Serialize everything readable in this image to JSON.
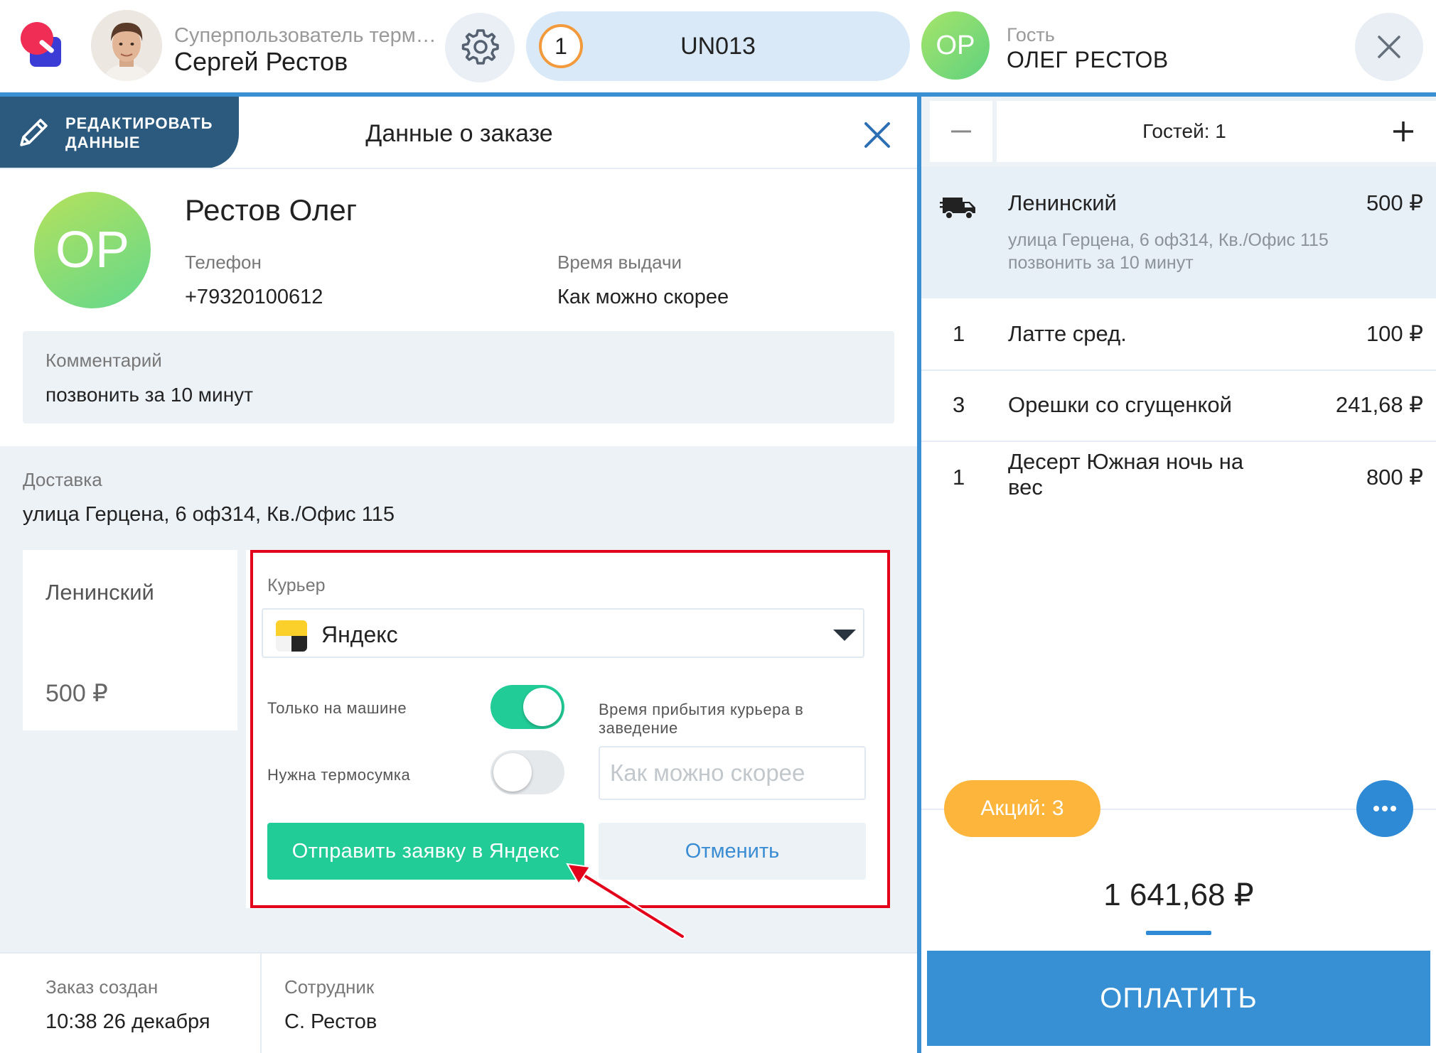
{
  "header": {
    "user_role": "Суперпользователь термин...",
    "user_name": "Сергей Рестов",
    "order_number": "1",
    "order_code": "UN013",
    "guest_initials": "OP",
    "guest_label": "Гость",
    "guest_name": "ОЛЕГ РЕСТОВ"
  },
  "panel": {
    "edit_label": "РЕДАКТИРОВАТЬ ДАННЫЕ",
    "title": "Данные о заказе"
  },
  "customer": {
    "initials": "OP",
    "name": "Рестов Олег",
    "phone_label": "Телефон",
    "phone": "+79320100612",
    "time_label": "Время выдачи",
    "time": "Как можно скорее",
    "comment_label": "Комментарий",
    "comment": "позвонить за 10 минут"
  },
  "delivery": {
    "label": "Доставка",
    "address": "улица Герцена, 6 оф314, Кв./Офис 115",
    "zone_name": "Ленинский",
    "zone_price": "500 ₽"
  },
  "courier": {
    "label": "Курьер",
    "selected": "Яндекс",
    "car_only_label": "Только на машине",
    "car_only": true,
    "thermo_bag_label": "Нужна термосумка",
    "thermo_bag": false,
    "arrival_label": "Время прибытия курьера в заведение",
    "arrival_placeholder": "Как можно скорее",
    "send_label": "Отправить заявку в Яндекс",
    "cancel_label": "Отменить"
  },
  "order_meta": {
    "created_label": "Заказ создан",
    "created_value": "10:38 26 декабря",
    "staff_label": "Сотрудник",
    "staff_value": "С. Рестов"
  },
  "cart": {
    "guests_label": "Гостей: 1",
    "delivery_row": {
      "title": "Ленинский",
      "price": "500 ₽",
      "address_line1": "улица Герцена, 6 оф314, Кв./Офис 115",
      "address_line2": "позвонить за 10 минут"
    },
    "items": [
      {
        "qty": "1",
        "name": "Латте сред.",
        "price": "100 ₽"
      },
      {
        "qty": "3",
        "name": "Орешки со сгущенкой",
        "price": "241,68 ₽"
      },
      {
        "qty": "1",
        "name": "Десерт Южная ночь на вес",
        "price": "800 ₽"
      }
    ],
    "promo_label": "Акций: 3",
    "total": "1 641,68 ₽",
    "pay_label": "ОПЛАТИТЬ"
  },
  "colors": {
    "accent_blue": "#3890d4",
    "teal": "#22cc97",
    "promo_orange": "#fdb53c",
    "highlight_red": "#e3001b"
  },
  "icons": [
    "app-logo-icon",
    "settings-gear-icon",
    "close-icon",
    "pencil-icon",
    "yandex-logo-icon",
    "chevron-down-icon",
    "truck-icon",
    "minus-icon",
    "plus-icon",
    "more-dots-icon"
  ]
}
